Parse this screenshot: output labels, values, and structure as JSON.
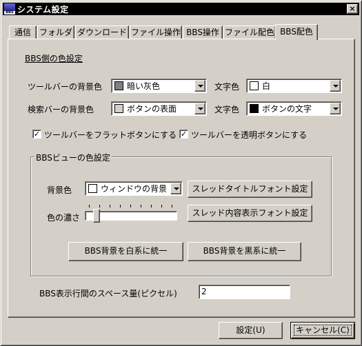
{
  "window": {
    "title": "システム設定",
    "icon_name": "app-icon",
    "icon_caption": "BBS"
  },
  "tabs": [
    "通信",
    "フォルダ",
    "ダウンロード",
    "ファイル操作",
    "BBS操作",
    "ファイル配色",
    "BBS配色"
  ],
  "active_tab": "BBS配色",
  "bbs_side": {
    "section_title": "BBS側の色設定",
    "toolbar_bg_label": "ツールバーの背景色",
    "toolbar_bg_value": "暗い灰色",
    "toolbar_bg_color": "#808080",
    "toolbar_text_label": "文字色",
    "toolbar_text_value": "白",
    "toolbar_text_color": "#ffffff",
    "searchbar_bg_label": "検索バーの背景色",
    "searchbar_bg_value": "ボタンの表面",
    "searchbar_bg_color": "#d4d0c8",
    "searchbar_text_label": "文字色",
    "searchbar_text_value": "ボタンの文字",
    "searchbar_text_color": "#000000",
    "flat_buttons_label": "ツールバーをフラットボタンにする",
    "flat_buttons_checked": true,
    "transparent_buttons_label": "ツールバーを透明ボタンにする",
    "transparent_buttons_checked": true
  },
  "bbs_view": {
    "group_title": "BBSビューの色設定",
    "bg_label": "背景色",
    "bg_value": "ウィンドウの背景",
    "bg_color": "#ffffff",
    "thread_title_font_button": "スレッドタイトルフォント設定",
    "density_label": "色の濃さ",
    "density_level": 0.1,
    "thread_content_font_button": "スレッド内容表示フォント設定",
    "white_unify_button": "BBS背景を白系に統一",
    "black_unify_button": "BBS背景を黒系に統一"
  },
  "spacing": {
    "label": "BBS表示行間のスペース量(ピクセル)",
    "value": "2"
  },
  "footer": {
    "ok_button": "設定(U)",
    "cancel_button": "キャンセル(C)"
  }
}
